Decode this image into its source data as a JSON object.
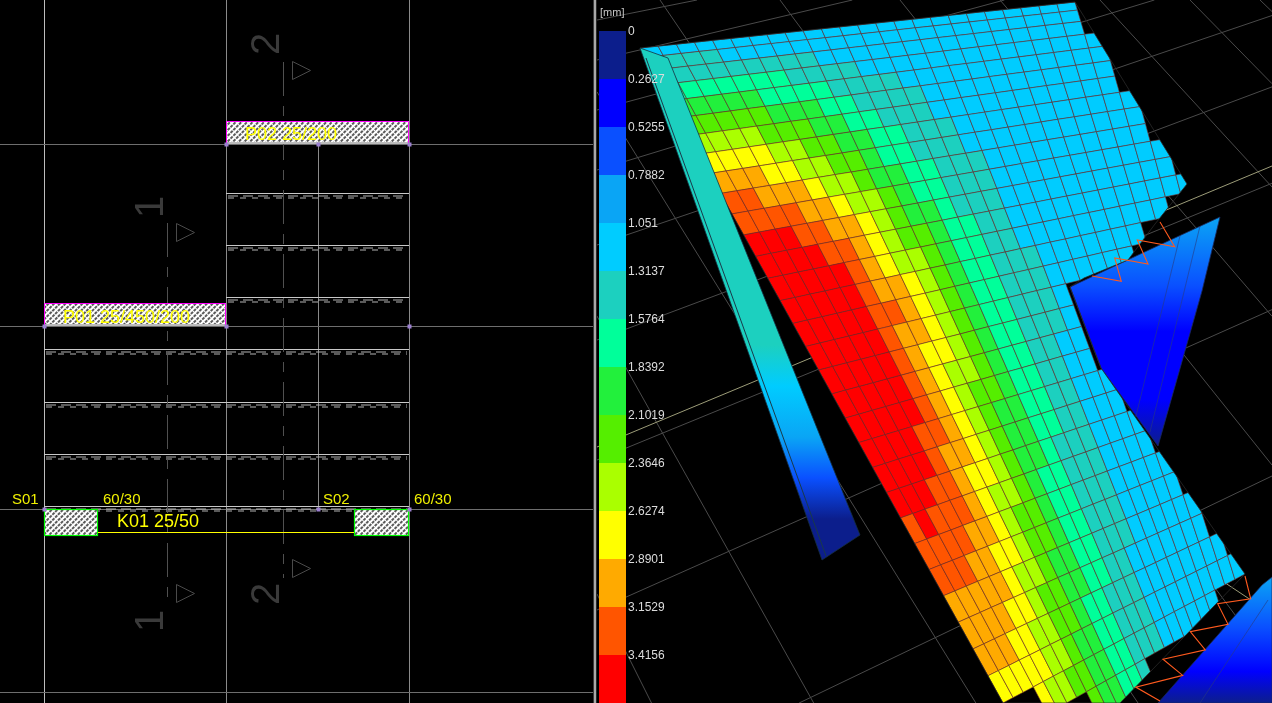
{
  "plan_view": {
    "walls": [
      {
        "label": "P02 25/200"
      },
      {
        "label": "P01 25/450/200"
      }
    ],
    "sections": [
      {
        "top_label": "1",
        "bottom_label": "1"
      },
      {
        "top_label": "2",
        "bottom_label": "2"
      }
    ],
    "columns": [
      {
        "label": "S01",
        "size": "60/30"
      },
      {
        "label": "S02",
        "size": "60/30"
      }
    ],
    "beams": [
      {
        "label": "K01 25/50"
      }
    ]
  },
  "results_view": {
    "legend": {
      "unit": "[mm]",
      "bands": [
        {
          "label": "0",
          "color": "#0c1e8c"
        },
        {
          "label": "0.2627",
          "color": "#0000ff"
        },
        {
          "label": "0.5255",
          "color": "#0a50ff"
        },
        {
          "label": "0.7882",
          "color": "#0aa5f5"
        },
        {
          "label": "1.051",
          "color": "#00ccff"
        },
        {
          "label": "1.3137",
          "color": "#1cd0bf"
        },
        {
          "label": "1.5764",
          "color": "#00ff9a"
        },
        {
          "label": "1.8392",
          "color": "#22f03c"
        },
        {
          "label": "2.1019",
          "color": "#55ee00"
        },
        {
          "label": "2.3646",
          "color": "#aaff00"
        },
        {
          "label": "2.6274",
          "color": "#ffff00"
        },
        {
          "label": "2.8901",
          "color": "#ffaa00"
        },
        {
          "label": "3.1529",
          "color": "#ff5500"
        },
        {
          "label": "3.4156",
          "color": "#ff0000"
        }
      ]
    }
  }
}
